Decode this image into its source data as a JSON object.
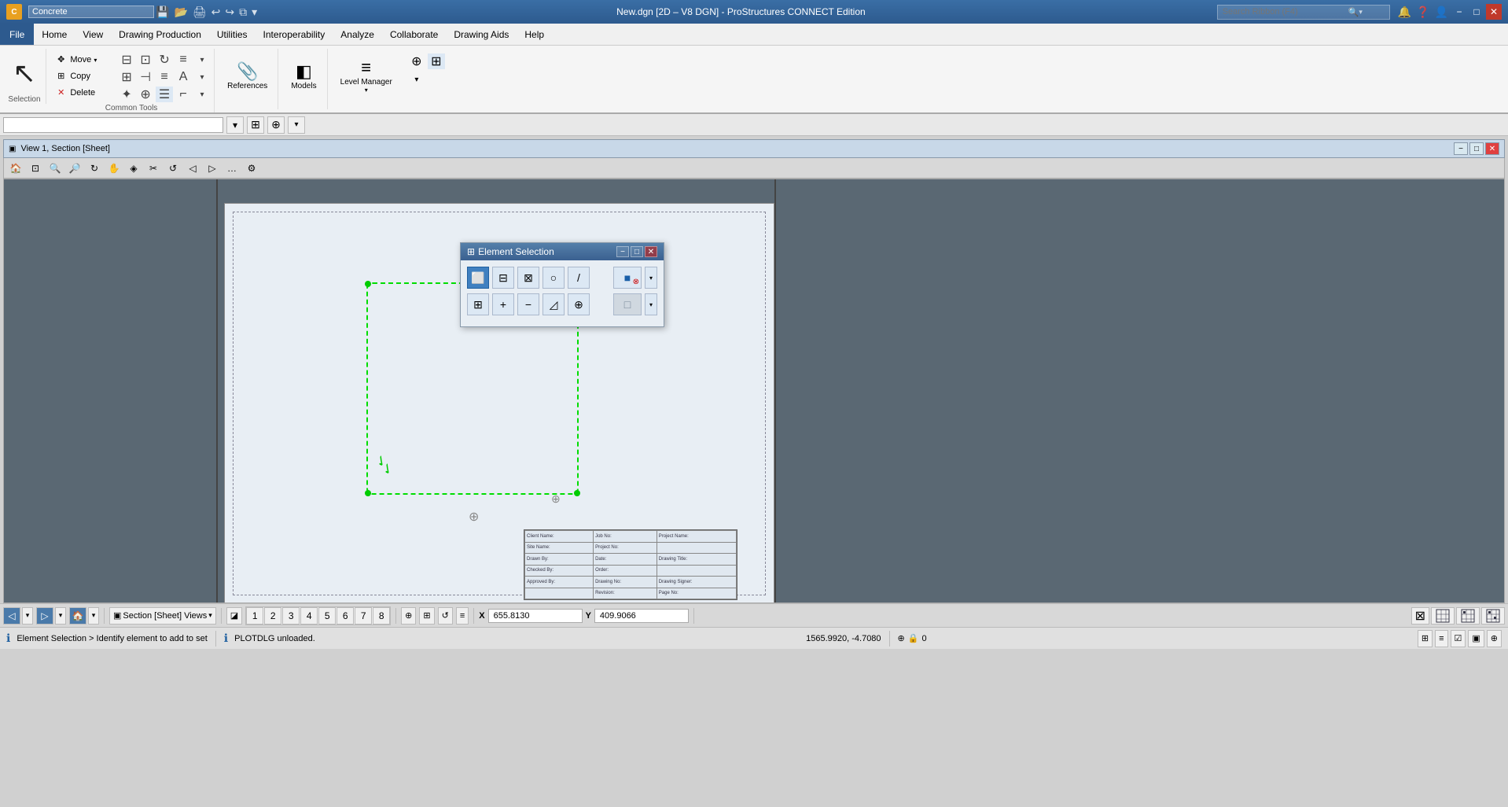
{
  "titlebar": {
    "app_icon": "C",
    "app_name": "Concrete",
    "title": "New.dgn [2D – V8 DGN] - ProStructures CONNECT Edition",
    "search_placeholder": "Search Ribbon (F4)",
    "minimize": "−",
    "restore": "□",
    "close": "✕"
  },
  "toolbar_icons": [
    "←",
    "→",
    "↺",
    "↻",
    "⊞",
    "⊟",
    "✱",
    "▶",
    "⊡"
  ],
  "menubar": {
    "items": [
      "File",
      "Home",
      "View",
      "Drawing Production",
      "Utilities",
      "Interoperability",
      "Analyze",
      "Collaborate",
      "Drawing Aids",
      "Help"
    ]
  },
  "ribbon": {
    "selection_label": "Selection",
    "common_tools_label": "Common Tools",
    "move_label": "Move",
    "copy_label": "Copy",
    "delete_label": "Delete",
    "references_label": "References",
    "models_label": "Models",
    "level_manager_label": "Level Manager"
  },
  "view": {
    "title": "View 1, Section [Sheet]",
    "minimize": "−",
    "restore": "□",
    "close": "✕"
  },
  "element_selection": {
    "title": "Element Selection",
    "minimize": "−",
    "restore": "□",
    "close": "✕"
  },
  "statusbar": {
    "message": "Element Selection > Identify element to add to set",
    "plotdlg": "PLOTDLG unloaded.",
    "coords": "1565.9920, -4.7080",
    "angle": "0"
  },
  "bottom_toolbar": {
    "view_label": "Section [Sheet] Views",
    "pages": [
      "1",
      "2",
      "3",
      "4",
      "5",
      "6",
      "7",
      "8"
    ],
    "x_label": "X",
    "x_value": "655.8130",
    "y_label": "Y",
    "y_value": "409.9066",
    "angle_value": "0"
  },
  "icons": {
    "arrow_cursor": "↖",
    "move": "✥",
    "copy": "⊕",
    "delete": "✕",
    "references": "⊞",
    "models": "◧",
    "level_mgr": "≡",
    "search": "🔍",
    "bell": "🔔",
    "help": "?",
    "user": "👤",
    "lock": "🔒",
    "grid": "⊞",
    "zoom": "⊕",
    "select_rect": "⬜",
    "select_circ": "⭕",
    "select_line": "/",
    "deselect": "⊖",
    "add": "+",
    "minus": "−",
    "diagonal": "◿",
    "target": "⊕"
  }
}
